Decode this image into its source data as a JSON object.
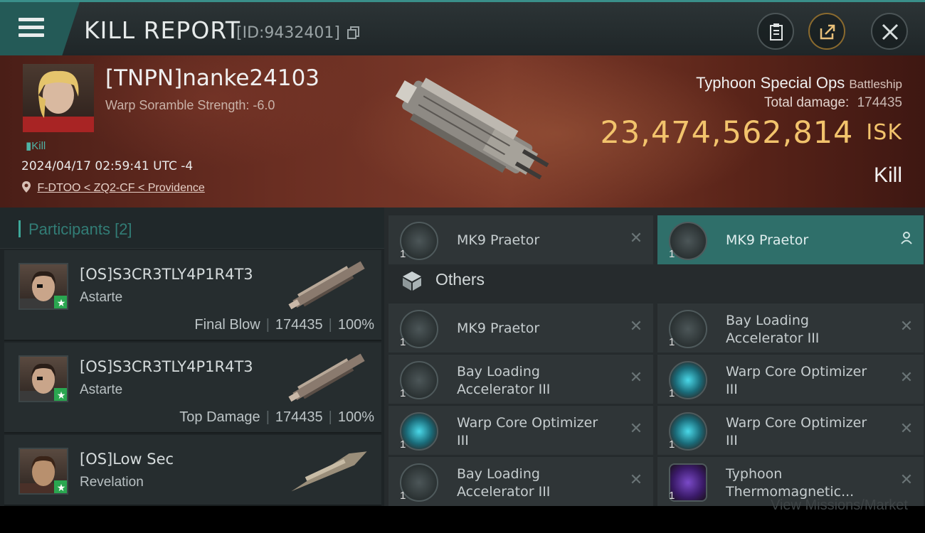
{
  "header": {
    "title": "KILL REPORT",
    "id_text": "[ID:9432401]"
  },
  "victim": {
    "name": "[TNPN]nanke24103",
    "warp_strength": "Warp Soramble Strength: -6.0",
    "kill_tag": "Kill",
    "date": "2024/04/17 02:59:41 UTC -4",
    "location": "F-DTOO < ZQ2-CF < Providence",
    "ship_name": "Typhoon Special Ops",
    "ship_class": "Battleship",
    "total_damage_label": "Total damage:",
    "total_damage_value": "174435",
    "isk_value": "23,474,562,814",
    "isk_unit": "ISK",
    "kill_type": "Kill"
  },
  "participants": {
    "title": "Participants",
    "count": "[2]",
    "items": [
      {
        "name": "[OS]S3CR3TLY4P1R4T3",
        "ship": "Astarte",
        "role": "Final Blow",
        "damage": "174435",
        "percent": "100%"
      },
      {
        "name": "[OS]S3CR3TLY4P1R4T3",
        "ship": "Astarte",
        "role": "Top Damage",
        "damage": "174435",
        "percent": "100%"
      },
      {
        "name": "[OS]Low Sec",
        "ship": "Revelation"
      }
    ]
  },
  "items": {
    "top": [
      {
        "name": "MK9  Praetor",
        "qty": "1"
      },
      {
        "name": "MK9  Praetor",
        "qty": "1"
      }
    ],
    "others_title": "Others",
    "others": [
      {
        "name_line1": "MK9  Praetor",
        "name_line2": "",
        "qty": "1"
      },
      {
        "name_line1": "Bay Loading",
        "name_line2": "Accelerator III",
        "qty": "1"
      },
      {
        "name_line1": "Bay Loading",
        "name_line2": "Accelerator III",
        "qty": "1"
      },
      {
        "name_line1": "Warp Core Optimizer",
        "name_line2": "III",
        "qty": "1"
      },
      {
        "name_line1": "Warp Core Optimizer",
        "name_line2": "III",
        "qty": "1"
      },
      {
        "name_line1": "Warp Core Optimizer",
        "name_line2": "III",
        "qty": "1"
      },
      {
        "name_line1": "Bay Loading",
        "name_line2": "Accelerator III",
        "qty": "1"
      },
      {
        "name_line1": "Typhoon",
        "name_line2": "Thermomagnetic...",
        "qty": "1"
      }
    ]
  },
  "footer": {
    "ghost_text": "View Missions/Market"
  },
  "colors": {
    "accent": "#3ea89a",
    "isk": "#f2c36c",
    "highlight_row": "#2f6f6a"
  }
}
